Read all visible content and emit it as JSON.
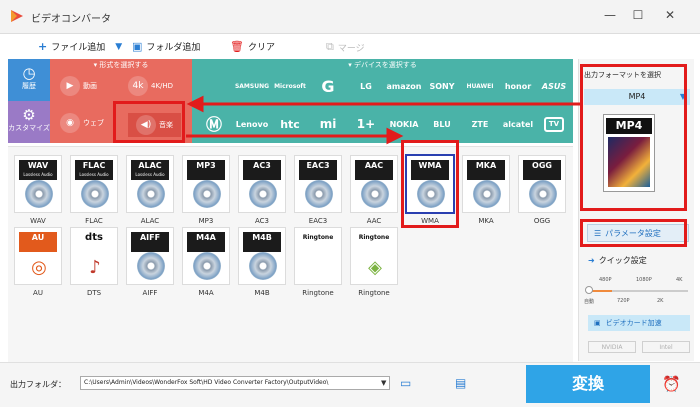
{
  "app": {
    "title": "ビデオコンバータ"
  },
  "toolbar": {
    "add_file": "ファイル追加",
    "add_folder": "フォルダ追加",
    "clear": "クリア",
    "merge": "マージ"
  },
  "sidebar": {
    "history": "履歴",
    "customize": "カスタマイズ"
  },
  "formats": {
    "header": "形式を選択する",
    "video": "動画",
    "hd": "4K/HD",
    "web": "ウェブ",
    "audio": "音楽"
  },
  "devices": {
    "header": "デバイスを選択する",
    "row1": [
      "",
      "SAMSUNG",
      "Microsoft",
      "G",
      "LG",
      "amazon",
      "SONY",
      "HUAWEI",
      "honor",
      "ASUS"
    ],
    "row2": [
      "",
      "Lenovo",
      "htc",
      "mi",
      "1+",
      "NOKIA",
      "BLU",
      "ZTE",
      "alcatel",
      "TV"
    ]
  },
  "audio_formats": [
    {
      "badge": "WAV",
      "sub": "Lossless Audio",
      "label": "WAV"
    },
    {
      "badge": "FLAC",
      "sub": "Lossless Audio",
      "label": "FLAC"
    },
    {
      "badge": "ALAC",
      "sub": "Lossless Audio",
      "label": "ALAC"
    },
    {
      "badge": "MP3",
      "sub": "",
      "label": "MP3"
    },
    {
      "badge": "AC3",
      "sub": "",
      "label": "AC3"
    },
    {
      "badge": "EAC3",
      "sub": "",
      "label": "EAC3"
    },
    {
      "badge": "AAC",
      "sub": "",
      "label": "AAC"
    },
    {
      "badge": "WMA",
      "sub": "",
      "label": "WMA"
    },
    {
      "badge": "MKA",
      "sub": "",
      "label": "MKA"
    },
    {
      "badge": "OGG",
      "sub": "",
      "label": "OGG"
    },
    {
      "badge": "AU",
      "sub": "",
      "label": "AU"
    },
    {
      "badge": "dts",
      "sub": "",
      "label": "DTS"
    },
    {
      "badge": "AIFF",
      "sub": "",
      "label": "AIFF"
    },
    {
      "badge": "M4A",
      "sub": "",
      "label": "M4A"
    },
    {
      "badge": "M4B",
      "sub": "",
      "label": "M4B"
    },
    {
      "badge": "Ringtone",
      "sub": "",
      "label": "Ringtone"
    },
    {
      "badge": "Ringtone",
      "sub": "",
      "label": "Ringtone"
    }
  ],
  "right_panel": {
    "title": "出力フォーマットを選択",
    "selected_format": "MP4",
    "format_card": "MP4",
    "param_button": "パラメータ設定",
    "quick_label": "クイック設定",
    "quality_ticks_top": [
      "480P",
      "1080P",
      "4K"
    ],
    "quality_ticks_bottom": [
      "自動",
      "720P",
      "2K"
    ],
    "gpu_label": "ビデオカード加速",
    "vendors": [
      "NVIDIA",
      "Intel"
    ]
  },
  "bottom": {
    "output_label": "出力フォルダ：",
    "output_path": "C:\\Users\\Admin\\Videos\\WonderFox Soft\\HD Video Converter Factory\\OutputVideo\\",
    "convert_button": "変換"
  },
  "colors": {
    "format_bg": "#e86b5f",
    "device_bg": "#4ab3a8",
    "accent": "#2fa4e7",
    "annotation": "#e21b1b"
  }
}
